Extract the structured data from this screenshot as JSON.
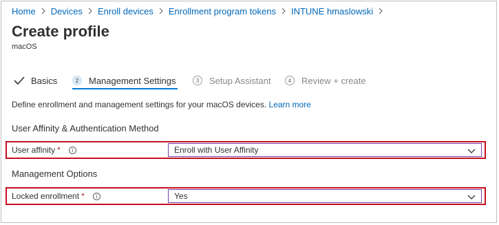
{
  "breadcrumb": [
    "Home",
    "Devices",
    "Enroll devices",
    "Enrollment program tokens",
    "INTUNE hmaslowski"
  ],
  "page": {
    "title": "Create profile",
    "subtitle": "macOS"
  },
  "steps": [
    {
      "number": "",
      "label": "Basics",
      "state": "completed"
    },
    {
      "number": "2",
      "label": "Management Settings",
      "state": "active"
    },
    {
      "number": "3",
      "label": "Setup Assistant",
      "state": "inactive"
    },
    {
      "number": "4",
      "label": "Review + create",
      "state": "inactive"
    }
  ],
  "description": {
    "text": "Define enrollment and management settings for your macOS devices.",
    "link": "Learn more"
  },
  "sections": {
    "auth": "User Affinity & Authentication Method",
    "management": "Management Options"
  },
  "fields": {
    "user_affinity": {
      "label": "User affinity",
      "required": "*",
      "value": "Enroll with User Affinity"
    },
    "locked_enrollment": {
      "label": "Locked enrollment",
      "required": "*",
      "value": "Yes"
    }
  },
  "icons": {
    "info": "info-icon",
    "chevron": "chevron-down-icon",
    "check": "checkmark-icon"
  },
  "colors": {
    "link": "#0067b8",
    "accent": "#0078d4",
    "highlight": "#c50f1f"
  }
}
